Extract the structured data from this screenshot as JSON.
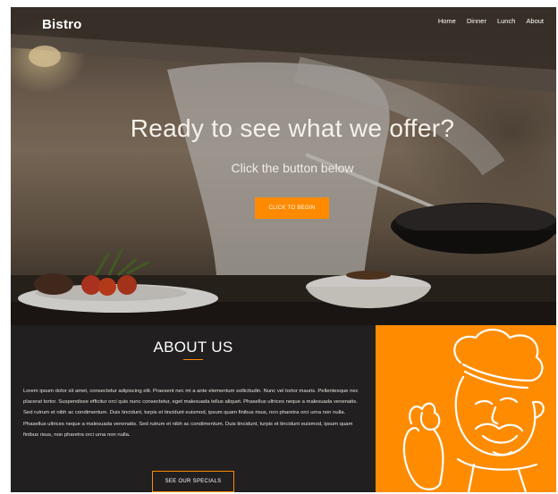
{
  "header": {
    "brand": "Bistro",
    "nav": [
      "Home",
      "Dinner",
      "Lunch",
      "About"
    ]
  },
  "hero": {
    "headline": "Ready to see what we offer?",
    "subline": "Click the button below",
    "cta_label": "CLICK TO BEGIN"
  },
  "about": {
    "title": "ABOUT US",
    "body": "Lorem ipsum dolor sit amet, consectetur adipiscing elit. Praesent nec mi a ante elementum sollicitudin. Nunc vel tortor mauris. Pellentesque nec placerat tortor. Suspendisse efficitur orci quis nunc consectetur, eget malesuada tellus aliquet. Phasellus ultrices neque a malesuada venenatis. Sed rutrum et nibh ac condimentum. Duis tincidunt, turpis et tincidunt euismod, ipsum quam finibus risus, non pharetra orci urna non nulla. Phasellus ultrices neque a malesuada venenatis. Sed rutrum et nibh ac condimentum. Duis tincidunt, turpis et tincidunt euismod, ipsum quam finibus risus, non pharetra orci urna non nulla.",
    "button_label": "SEE OUR SPECIALS"
  },
  "colors": {
    "accent": "#ff8a00",
    "dark_panel": "#211f1f",
    "chef_panel": "#ff8c00"
  },
  "icons": {
    "hero_image": "chef-cooking-photo",
    "about_image": "chef-illustration"
  }
}
